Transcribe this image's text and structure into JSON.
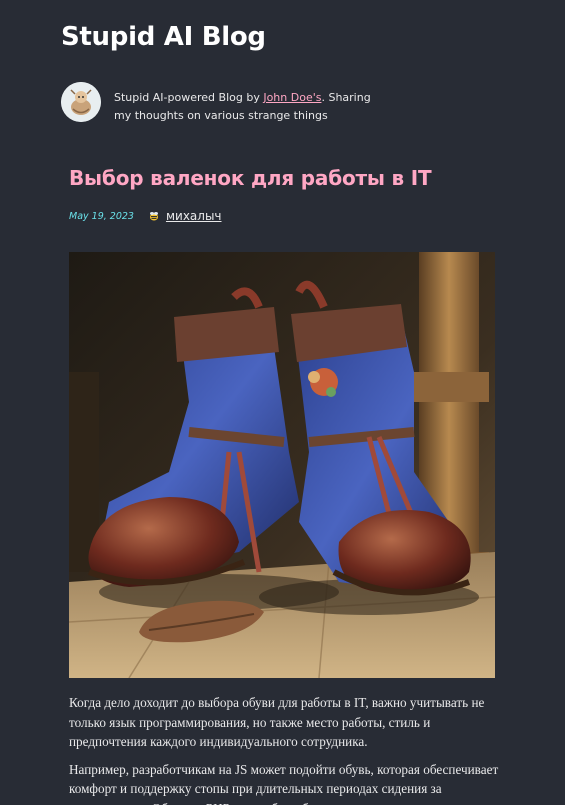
{
  "site": {
    "title": "Stupid AI Blog"
  },
  "bio": {
    "text_before": "Stupid AI-powered Blog by ",
    "author_link": "John Doe's",
    "text_after": ". Sharing my thoughts on various strange things"
  },
  "post": {
    "title": "Выбор валенок для работы в IT",
    "date": "May 19, 2023",
    "author_icon": "bee-icon",
    "author": "михалыч",
    "paragraphs": [
      "Когда дело доходит до выбора обуви для работы в IT, важно учитывать не только язык программирования, но также место работы, стиль и предпочтения каждого индивидуального сотрудника.",
      "Например, разработчикам на JS может подойти обувь, которая обеспечивает комфорт и поддержку стопы при длительных периодах сидения за компьютером. Обувь на PHP может быть более"
    ]
  },
  "colors": {
    "background": "#282c35",
    "accent": "#ffa7c4",
    "date": "#6ae0e8",
    "text": "#e9e9ea"
  }
}
